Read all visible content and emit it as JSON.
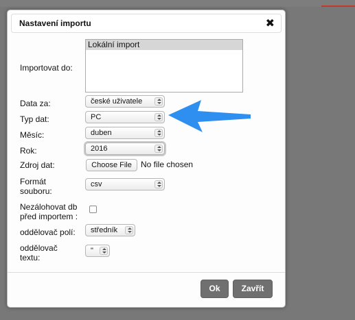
{
  "dialog": {
    "title": "Nastavení importu",
    "close_symbol": "✖"
  },
  "form": {
    "import_to": {
      "label": "Importovat do:",
      "options": [
        "Lokální import"
      ]
    },
    "data_for": {
      "label": "Data za:",
      "value": "české uživatele"
    },
    "data_type": {
      "label": "Typ dat:",
      "value": "PC"
    },
    "month": {
      "label": "Měsíc:",
      "value": "duben"
    },
    "year": {
      "label": "Rok:",
      "value": "2016"
    },
    "source": {
      "label": "Zdroj dat:",
      "button": "Choose File",
      "status": "No file chosen"
    },
    "format": {
      "label_line1": "Formát",
      "label_line2": "souboru:",
      "value": "csv"
    },
    "no_duplicates": {
      "label_line1": "Nezálohovat db",
      "label_line2": "před importem :",
      "checked": false
    },
    "field_separator": {
      "label": "oddělovač polí:",
      "value": "středník"
    },
    "text_separator": {
      "label_line1": "oddělovač",
      "label_line2": "textu:",
      "value": "\""
    }
  },
  "footer": {
    "ok_label": "Ok",
    "close_label": "Zavřít"
  },
  "annotation": {
    "icon": "blue-arrow-icon",
    "color": "#2f8ff0"
  },
  "colors": {
    "overlay": "#787878",
    "button": "#707070"
  }
}
